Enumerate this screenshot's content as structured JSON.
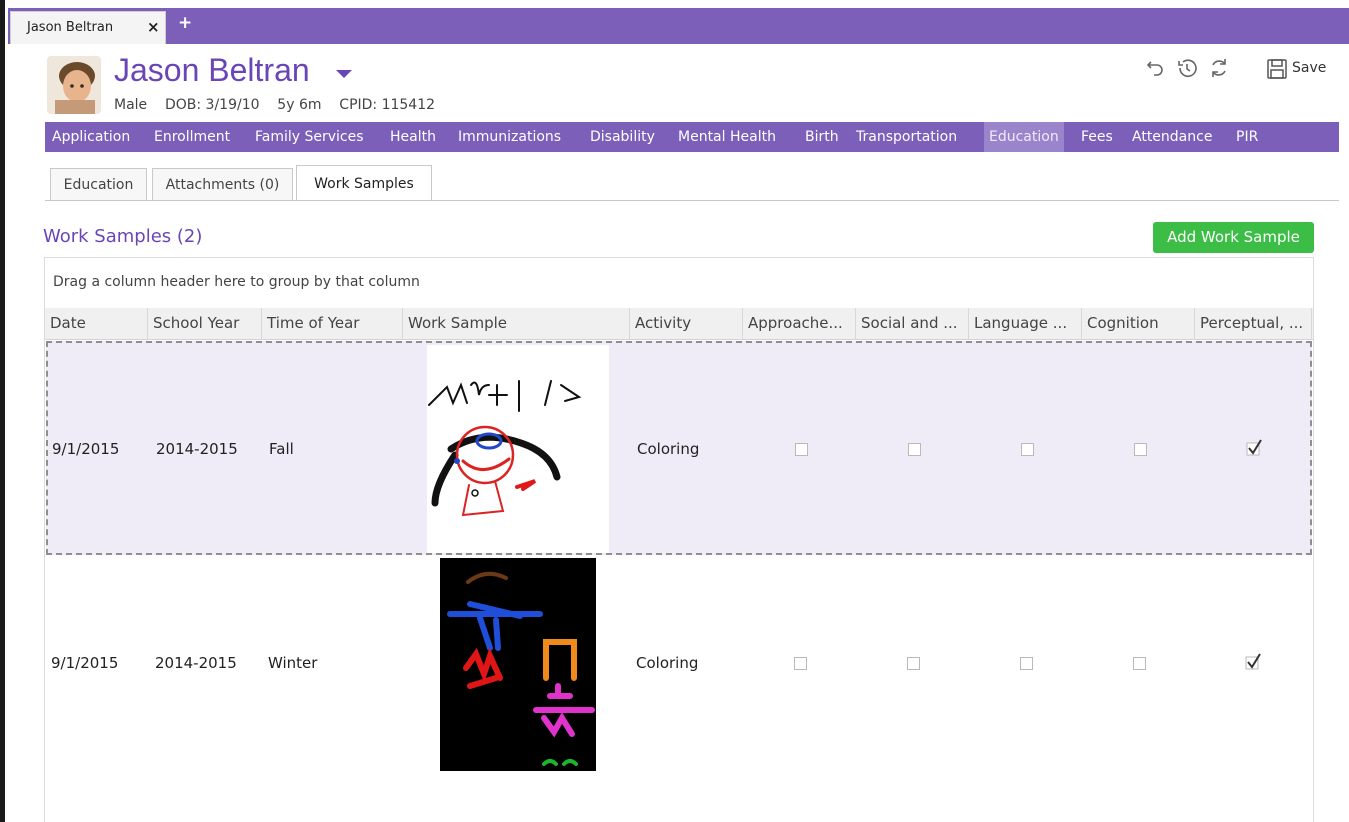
{
  "window_tab": {
    "label": "Jason Beltran",
    "close_glyph": "×",
    "add_glyph": "+"
  },
  "header": {
    "name": "Jason Beltran",
    "info": "Male    DOB: 3/19/10    5y 6m    CPID: 115412",
    "save_label": "Save",
    "icons": [
      "undo-icon",
      "history-icon",
      "refresh-icon",
      "save-icon"
    ]
  },
  "module_nav": [
    "Application",
    "Enrollment",
    "Family Services",
    "Health",
    "Immunizations",
    "Disability",
    "Mental Health",
    "Birth",
    "Transportation",
    "Education",
    "Fees",
    "Attendance",
    "PIR"
  ],
  "module_nav_active": "Education",
  "sub_tabs": [
    "Education",
    "Attachments (0)",
    "Work Samples"
  ],
  "sub_tab_active": "Work Samples",
  "section": {
    "title": "Work Samples (2)",
    "add_button": "Add Work Sample"
  },
  "grid": {
    "group_hint": "Drag a column header here to group by that column",
    "columns": [
      "Date",
      "School Year",
      "Time of Year",
      "Work Sample",
      "Activity",
      "Approache...",
      "Social and ...",
      "Language ...",
      "Cognition",
      "Perceptual, ..."
    ],
    "rows": [
      {
        "date": "9/1/2015",
        "school_year": "2014-2015",
        "time_of_year": "Fall",
        "sample_bg": "white",
        "activity": "Coloring",
        "checks": [
          false,
          false,
          false,
          false,
          true
        ],
        "selected": true
      },
      {
        "date": "9/1/2015",
        "school_year": "2014-2015",
        "time_of_year": "Winter",
        "sample_bg": "black",
        "activity": "Coloring",
        "checks": [
          false,
          false,
          false,
          false,
          true
        ],
        "selected": false
      }
    ]
  },
  "colors": {
    "purple": "#7b5fb8",
    "title_purple": "#6a45b5",
    "green": "#3bbd46",
    "selected_row": "#efecf8"
  }
}
